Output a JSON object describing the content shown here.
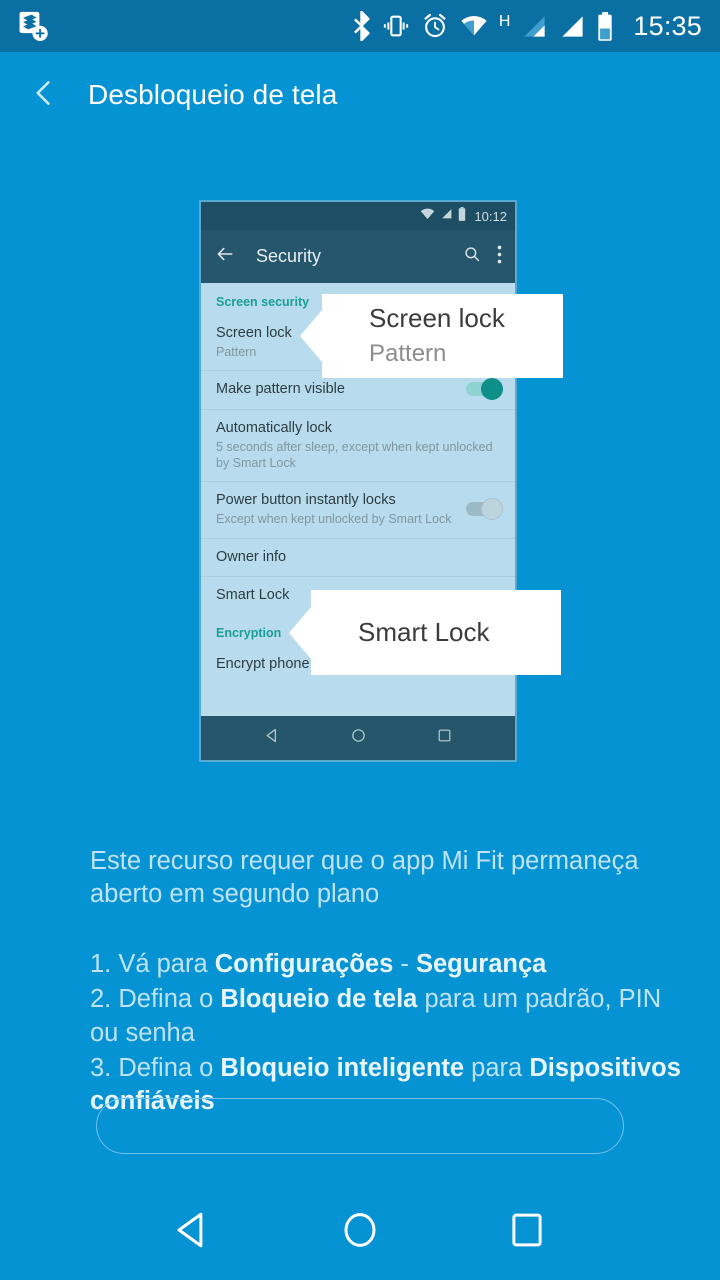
{
  "status_bar": {
    "app_icon": "document-stack-add-icon",
    "icons": [
      "bluetooth-icon",
      "vibrate-icon",
      "alarm-icon",
      "wifi-icon",
      "hspa-network-icon",
      "signal-bars-sim1-icon",
      "signal-bars-sim2-icon",
      "battery-icon"
    ],
    "hspa_label": "H",
    "clock": "15:35"
  },
  "app_bar": {
    "back_icon": "chevron-left-icon",
    "title": "Desbloqueio de tela"
  },
  "screenshot": {
    "status": {
      "icons": [
        "wifi-icon",
        "signal-bars-icon",
        "battery-icon"
      ],
      "time": "10:12"
    },
    "app_bar": {
      "back_icon": "arrow-left-icon",
      "title": "Security",
      "search_icon": "search-icon",
      "overflow_icon": "more-vert-icon"
    },
    "sections": [
      {
        "header": "Screen security",
        "rows": [
          {
            "title": "Screen lock",
            "subtitle": "Pattern",
            "control": "none"
          },
          {
            "title": "Make pattern visible",
            "subtitle": "",
            "control": "toggle-on"
          },
          {
            "title": "Automatically lock",
            "subtitle": "5 seconds after sleep, except when kept unlocked by Smart Lock",
            "control": "none"
          },
          {
            "title": "Power button instantly locks",
            "subtitle": "Except when kept unlocked by Smart Lock",
            "control": "toggle-off"
          },
          {
            "title": "Owner info",
            "subtitle": "",
            "control": "none"
          },
          {
            "title": "Smart Lock",
            "subtitle": "",
            "control": "none"
          }
        ]
      },
      {
        "header": "Encryption",
        "rows": [
          {
            "title": "Encrypt phone",
            "subtitle": "",
            "control": "none"
          }
        ]
      }
    ],
    "nav": [
      "back-triangle-icon",
      "home-circle-icon",
      "recents-square-icon"
    ]
  },
  "callouts": [
    {
      "title": "Screen lock",
      "subtitle": "Pattern"
    },
    {
      "title": "Smart Lock",
      "subtitle": ""
    }
  ],
  "instructions": {
    "intro": "Este recurso requer que o app Mi Fit permaneça aberto em segundo plano",
    "steps": [
      {
        "prefix": "1. Vá para ",
        "bold1": "Configurações",
        "middle": " - ",
        "bold2": "Segurança",
        "suffix": ""
      },
      {
        "prefix": "2. Defina o ",
        "bold1": "Bloqueio de tela",
        "middle": " para um padrão, PIN ou senha",
        "bold2": "",
        "suffix": ""
      },
      {
        "prefix": "3. Defina o ",
        "bold1": "Bloqueio inteligente",
        "middle": " para ",
        "bold2": "Dispositivos confiáveis",
        "suffix": ""
      }
    ]
  },
  "cta": {
    "label": ""
  },
  "system_nav": {
    "back": "back-triangle-icon",
    "home": "home-circle-icon",
    "recents": "recents-square-icon"
  },
  "colors": {
    "background": "#0693d3",
    "status_bar": "#0a6fa3",
    "screenshot_list_bg": "#b8dced",
    "screenshot_appbar": "#26566b",
    "section_header": "#1a9e96",
    "toggle_on": "#0e8f8a",
    "text_light": "#bfe2f4",
    "text_bold": "#e8f5fd"
  }
}
